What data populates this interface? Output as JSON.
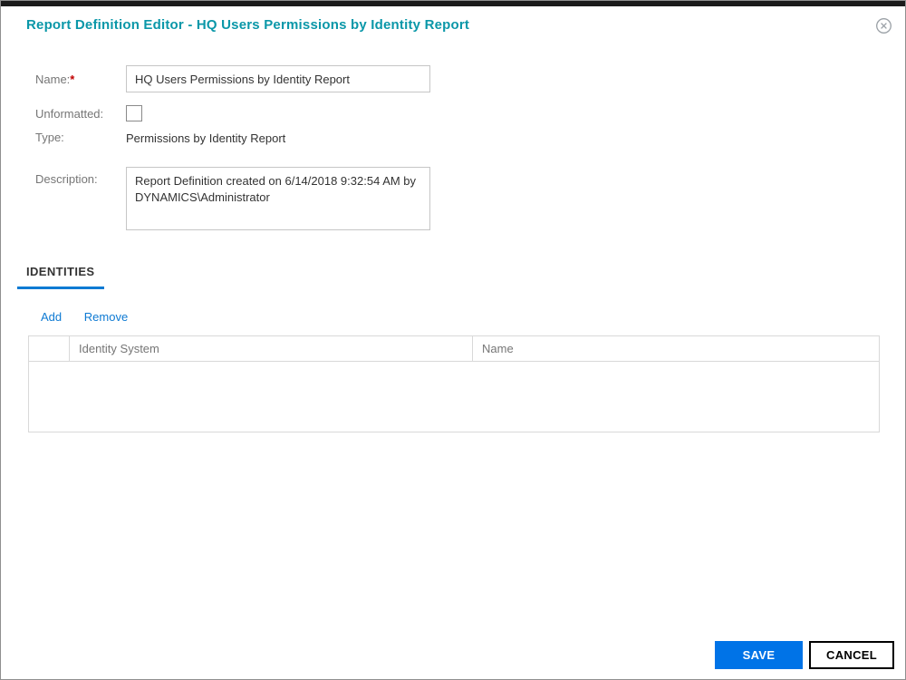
{
  "colors": {
    "title_teal": "#0a97a8",
    "accent_blue": "#0073e7",
    "link_blue": "#0e7ad3",
    "label_gray": "#767676",
    "save_button_bg": "#0073e7"
  },
  "dialog": {
    "title": "Report Definition Editor - HQ Users Permissions by Identity Report"
  },
  "form": {
    "name_label": "Name:",
    "name_required": "*",
    "name_value": "HQ Users Permissions by Identity Report",
    "unformatted_label": "Unformatted:",
    "unformatted_checked": false,
    "type_label": "Type:",
    "type_value": "Permissions by Identity Report",
    "description_label": "Description:",
    "description_value": "Report Definition created on 6/14/2018 9:32:54 AM by DYNAMICS\\Administrator"
  },
  "tabs": [
    {
      "label": "IDENTITIES",
      "active": true
    }
  ],
  "actions": {
    "add": "Add",
    "remove": "Remove"
  },
  "table": {
    "headers": [
      "Identity System",
      "Name"
    ],
    "rows": []
  },
  "footer": {
    "save": "SAVE",
    "cancel": "CANCEL"
  }
}
